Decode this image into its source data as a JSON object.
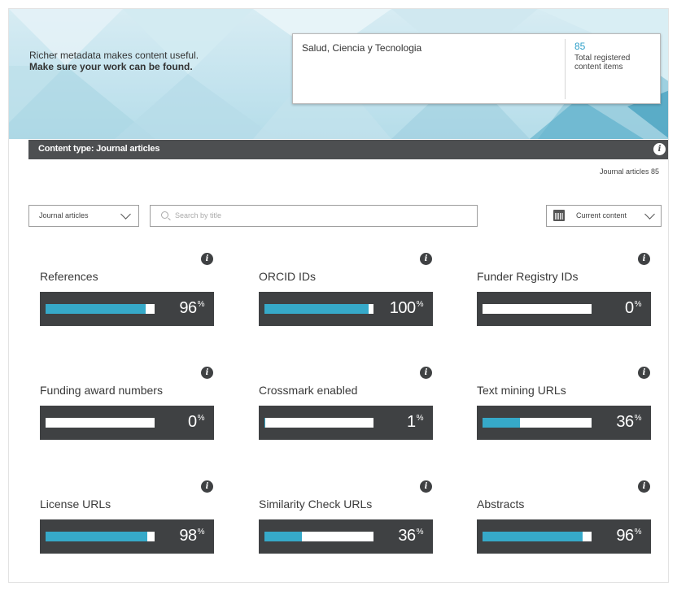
{
  "banner": {
    "line1": "Richer metadata makes content useful.",
    "line2": "Make sure your work can be found."
  },
  "journal": {
    "title": "Salud, Ciencia y Tecnologia",
    "count": "85",
    "count_label": "Total registered content items"
  },
  "content_type": {
    "label": "Content type: Journal articles",
    "articles_count": "Journal articles 85"
  },
  "filters": {
    "type_select": "Journal articles",
    "search_placeholder": "Search by title",
    "period_select": "Current content"
  },
  "metrics": [
    {
      "label": "References",
      "percent": 96,
      "display": "96"
    },
    {
      "label": "ORCID IDs",
      "percent": 100,
      "display": "100"
    },
    {
      "label": "Funder Registry IDs",
      "percent": 0,
      "display": "0"
    },
    {
      "label": "Funding award numbers",
      "percent": 0,
      "display": "0"
    },
    {
      "label": "Crossmark enabled",
      "percent": 1,
      "display": "1"
    },
    {
      "label": "Text mining URLs",
      "percent": 36,
      "display": "36"
    },
    {
      "label": "License URLs",
      "percent": 98,
      "display": "98"
    },
    {
      "label": "Similarity Check URLs",
      "percent": 36,
      "display": "36"
    },
    {
      "label": "Abstracts",
      "percent": 96,
      "display": "96"
    }
  ],
  "percent_sign": "%",
  "info_glyph": "i",
  "colors": {
    "accent": "#36a9c9",
    "meter_bg": "#3f4143",
    "header_bar": "#4d4f51"
  }
}
